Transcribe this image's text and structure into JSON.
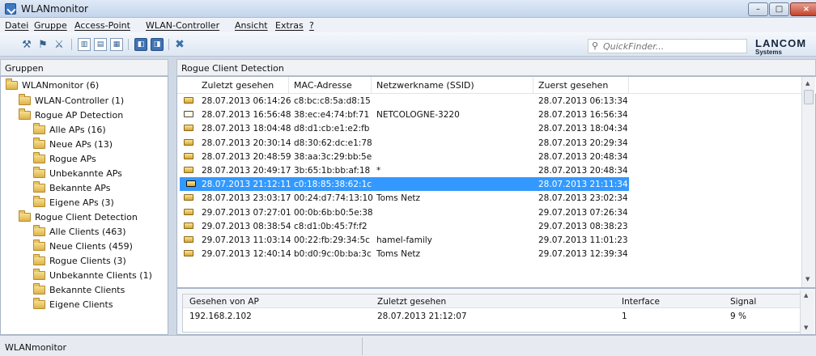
{
  "window": {
    "title": "WLANmonitor",
    "min_glyph": "–",
    "max_glyph": "□",
    "close_glyph": "×"
  },
  "menu": [
    "Datei",
    "Gruppe",
    "Access-Point",
    "WLAN-Controller",
    "Ansicht",
    "Extras",
    "?"
  ],
  "toolbar": {
    "search_placeholder": "QuickFinder...",
    "search_glyph": "⚲",
    "brand": "LANCOM",
    "brand_sub": "Systems",
    "icons": [
      {
        "name": "antenna-tool-icon",
        "glyph": "⚒"
      },
      {
        "name": "antenna-scan-icon",
        "glyph": "⚑"
      },
      {
        "name": "antenna-remove-icon",
        "glyph": "⚔"
      },
      {
        "name": "layout-columns-icon",
        "glyph": "▥"
      },
      {
        "name": "layout-rows-icon",
        "glyph": "▤"
      },
      {
        "name": "layout-detail-icon",
        "glyph": "▦"
      },
      {
        "name": "window-left-icon",
        "glyph": "◧"
      },
      {
        "name": "window-right-icon",
        "glyph": "◨"
      },
      {
        "name": "delete-icon",
        "glyph": "✖"
      }
    ]
  },
  "left_pane": {
    "header": "Gruppen",
    "tree": [
      {
        "label": "WLANmonitor (6)",
        "level": 0
      },
      {
        "label": "WLAN-Controller (1)",
        "level": 1
      },
      {
        "label": "Rogue AP Detection",
        "level": 1
      },
      {
        "label": "Alle APs (16)",
        "level": 2
      },
      {
        "label": "Neue APs (13)",
        "level": 2
      },
      {
        "label": "Rogue APs",
        "level": 2
      },
      {
        "label": "Unbekannte APs",
        "level": 2
      },
      {
        "label": "Bekannte APs",
        "level": 2
      },
      {
        "label": "Eigene APs (3)",
        "level": 2
      },
      {
        "label": "Rogue Client Detection",
        "level": 1
      },
      {
        "label": "Alle Clients (463)",
        "level": 2
      },
      {
        "label": "Neue Clients (459)",
        "level": 2
      },
      {
        "label": "Rogue Clients (3)",
        "level": 2
      },
      {
        "label": "Unbekannte Clients (1)",
        "level": 2
      },
      {
        "label": "Bekannte Clients",
        "level": 2
      },
      {
        "label": "Eigene Clients",
        "level": 2
      }
    ]
  },
  "main": {
    "header": "Rogue Client Detection",
    "columns": [
      "Zuletzt gesehen",
      "MAC-Adresse",
      "Netzwerkname (SSID)",
      "Zuerst gesehen"
    ],
    "selected_row": 6,
    "rows": [
      {
        "last_seen": "28.07.2013 06:14:26",
        "mac": "c8:bc:c8:5a:d8:15",
        "ssid": "",
        "first_seen": "28.07.2013 06:13:34",
        "icon": "client-yellow-icon"
      },
      {
        "last_seen": "28.07.2013 16:56:48",
        "mac": "38:ec:e4:74:bf:71",
        "ssid": "NETCOLOGNE-3220",
        "first_seen": "28.07.2013 16:56:34",
        "icon": "client-white-icon"
      },
      {
        "last_seen": "28.07.2013 18:04:48",
        "mac": "d8:d1:cb:e1:e2:fb",
        "ssid": "",
        "first_seen": "28.07.2013 18:04:34",
        "icon": "client-yellow-icon"
      },
      {
        "last_seen": "28.07.2013 20:30:14",
        "mac": "d8:30:62:dc:e1:78",
        "ssid": "",
        "first_seen": "28.07.2013 20:29:34",
        "icon": "client-yellow-icon"
      },
      {
        "last_seen": "28.07.2013 20:48:59",
        "mac": "38:aa:3c:29:bb:5e",
        "ssid": "",
        "first_seen": "28.07.2013 20:48:34",
        "icon": "client-yellow-icon"
      },
      {
        "last_seen": "28.07.2013 20:49:17",
        "mac": "3b:65:1b:bb:af:18",
        "ssid": "*",
        "first_seen": "28.07.2013 20:48:34",
        "icon": "client-yellow-icon"
      },
      {
        "last_seen": "28.07.2013 21:12:11",
        "mac": "c0:18:85:38:62:1c",
        "ssid": "",
        "first_seen": "28.07.2013 21:11:34",
        "icon": "client-yellow-icon"
      },
      {
        "last_seen": "28.07.2013 23:03:17",
        "mac": "00:24:d7:74:13:10",
        "ssid": "Toms Netz",
        "first_seen": "28.07.2013 23:02:34",
        "icon": "client-yellow-icon"
      },
      {
        "last_seen": "29.07.2013 07:27:01",
        "mac": "00:0b:6b:b0:5e:38",
        "ssid": "",
        "first_seen": "29.07.2013 07:26:34",
        "icon": "client-yellow-icon"
      },
      {
        "last_seen": "29.07.2013 08:38:54",
        "mac": "c8:d1:0b:45:7f:f2",
        "ssid": "",
        "first_seen": "29.07.2013 08:38:23",
        "icon": "client-yellow-icon"
      },
      {
        "last_seen": "29.07.2013 11:03:14",
        "mac": "00:22:fb:29:34:5c",
        "ssid": "hamel-family",
        "first_seen": "29.07.2013 11:01:23",
        "icon": "client-yellow-icon"
      },
      {
        "last_seen": "29.07.2013 12:40:14",
        "mac": "b0:d0:9c:0b:ba:3c",
        "ssid": "Toms Netz",
        "first_seen": "29.07.2013 12:39:34",
        "icon": "client-yellow-icon"
      }
    ]
  },
  "detail": {
    "headers": [
      "Gesehen von AP",
      "Zuletzt gesehen",
      "Interface",
      "Signal"
    ],
    "row": [
      "192.168.2.102",
      "28.07.2013 21:12:07",
      "1",
      "9 %"
    ]
  },
  "status": {
    "text": "WLANmonitor"
  },
  "colors": {
    "selection": "#3399ff",
    "title_bar": "#c9d8ee"
  }
}
